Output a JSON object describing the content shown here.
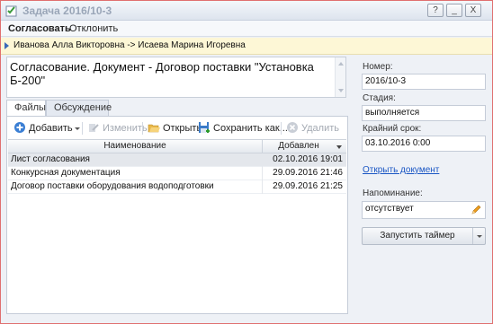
{
  "window": {
    "title": "Задача 2016/10-3",
    "help_label": "?",
    "minimize_label": "_",
    "close_label": "X"
  },
  "menu": {
    "approve": "Согласовать",
    "reject": "Отклонить"
  },
  "route": {
    "text": "Иванова Алла Викторовна -> Исаева Марина Игоревна"
  },
  "subject": {
    "text": "Согласование. Документ - Договор поставки \"Установка Б-200\""
  },
  "tabs": [
    {
      "label": "Файлы"
    },
    {
      "label": "Обсуждение"
    }
  ],
  "toolbar": {
    "add": "Добавить",
    "edit": "Изменить",
    "open": "Открыть",
    "save_as": "Сохранить как...",
    "delete": "Удалить"
  },
  "grid": {
    "col_name": "Наименование",
    "col_added": "Добавлен",
    "rows": [
      {
        "name": "Лист согласования",
        "added": "02.10.2016 19:01"
      },
      {
        "name": "Конкурсная документация",
        "added": "29.09.2016 21:46"
      },
      {
        "name": "Договор поставки оборудования водоподготовки",
        "added": "29.09.2016 21:25"
      }
    ]
  },
  "side": {
    "number_label": "Номер:",
    "number_value": "2016/10-3",
    "stage_label": "Стадия:",
    "stage_value": "выполняется",
    "deadline_label": "Крайний срок:",
    "deadline_value": "03.10.2016 0:00",
    "open_doc_link": "Открыть документ",
    "reminder_label": "Напоминание:",
    "reminder_value": "отсутствует",
    "timer_button": "Запустить таймер"
  },
  "colors": {
    "accent_link": "#1a56c4",
    "route_bg": "#fdf7d6",
    "selected_row": "#e4e7ec"
  }
}
